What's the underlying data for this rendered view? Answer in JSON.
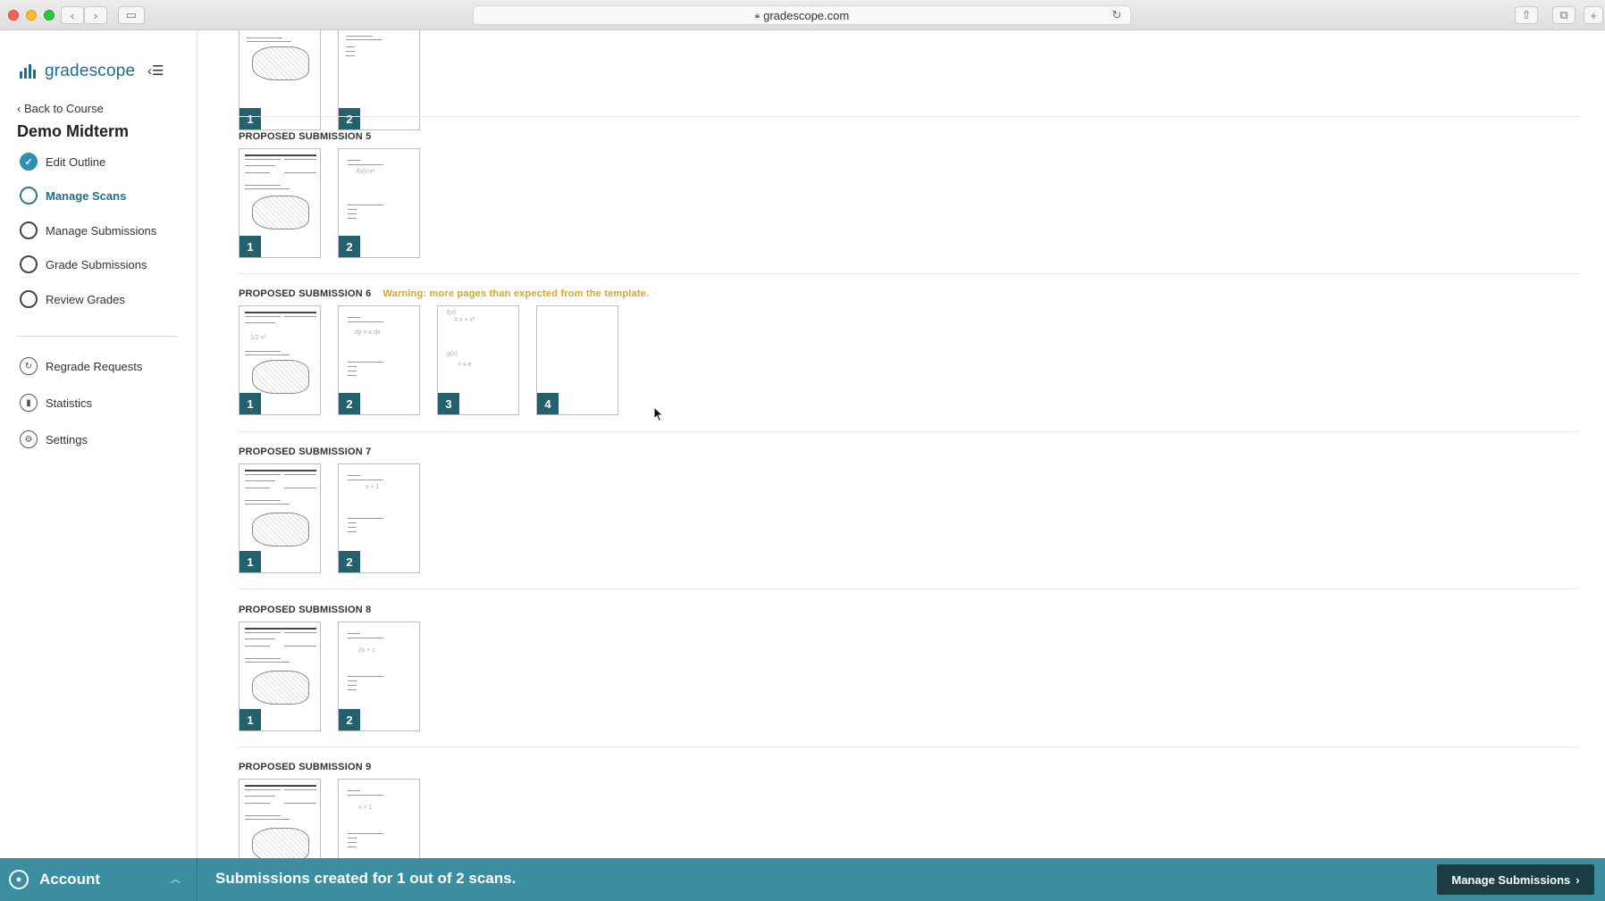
{
  "browser": {
    "url": "gradescope.com"
  },
  "sidebar": {
    "brand": "gradescope",
    "back_link": "Back to Course",
    "assignment_title": "Demo Midterm",
    "steps": [
      {
        "label": "Edit Outline",
        "state": "done"
      },
      {
        "label": "Manage Scans",
        "state": "active"
      },
      {
        "label": "Manage Submissions",
        "state": "todo"
      },
      {
        "label": "Grade Submissions",
        "state": "todo"
      },
      {
        "label": "Review Grades",
        "state": "todo"
      }
    ],
    "tools": [
      {
        "label": "Regrade Requests",
        "icon": "regrade-icon"
      },
      {
        "label": "Statistics",
        "icon": "statistics-icon"
      },
      {
        "label": "Settings",
        "icon": "gear-icon"
      }
    ]
  },
  "submissions": [
    {
      "title": "",
      "warning": "",
      "pages": [
        "1",
        "2"
      ]
    },
    {
      "title": "PROPOSED SUBMISSION 5",
      "warning": "",
      "pages": [
        "1",
        "2"
      ]
    },
    {
      "title": "PROPOSED SUBMISSION 6",
      "warning": "Warning: more pages than expected from the template.",
      "pages": [
        "1",
        "2",
        "3",
        "4"
      ]
    },
    {
      "title": "PROPOSED SUBMISSION 7",
      "warning": "",
      "pages": [
        "1",
        "2"
      ]
    },
    {
      "title": "PROPOSED SUBMISSION 8",
      "warning": "",
      "pages": [
        "1",
        "2"
      ]
    },
    {
      "title": "PROPOSED SUBMISSION 9",
      "warning": "",
      "pages": [
        "",
        ""
      ]
    }
  ],
  "bottombar": {
    "account_label": "Account",
    "status": "Submissions created for 1 out of 2 scans.",
    "manage_button": "Manage Submissions"
  },
  "colors": {
    "brand": "#1f6e8c",
    "bottom_bar": "#3a8ea0",
    "page_badge": "#24616f",
    "warning": "#d4a531"
  }
}
